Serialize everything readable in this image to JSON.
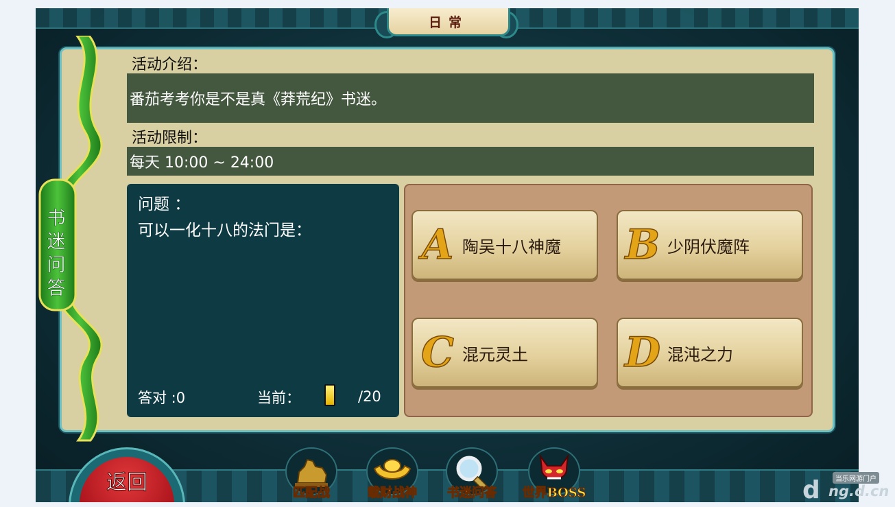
{
  "header": {
    "tab_title": "日常"
  },
  "side_tab": {
    "label": "书迷问答"
  },
  "activity": {
    "intro_label": "活动介绍：",
    "intro_text": "番茄考考你是不是真《莽荒纪》书迷。",
    "limit_label": "活动限制：",
    "limit_text": "每天 10:00 ~ 24:00"
  },
  "question": {
    "title": "问题 ：",
    "text": "可以一化十八的法门是：",
    "correct_label": "答对 :0",
    "current_label": "当前：",
    "current_value": 1,
    "total_label": "/20"
  },
  "answers": [
    {
      "letter": "A",
      "text": "陶吴十八神魔"
    },
    {
      "letter": "B",
      "text": "少阴伏魔阵"
    },
    {
      "letter": "C",
      "text": "混元灵土"
    },
    {
      "letter": "D",
      "text": "混沌之力"
    }
  ],
  "bottom": {
    "back_label": "返回",
    "modes": [
      {
        "label": "匹配战",
        "icon": "beast-statue-icon"
      },
      {
        "label": "载财战神",
        "icon": "gold-ingot-icon"
      },
      {
        "label": "书迷问答",
        "icon": "magnifier-icon"
      },
      {
        "label": "世界BOSS",
        "icon": "demon-mask-icon"
      }
    ]
  },
  "watermark": {
    "line1": "当乐网游门户",
    "line2": "ng.d.cn",
    "logo": "d"
  }
}
